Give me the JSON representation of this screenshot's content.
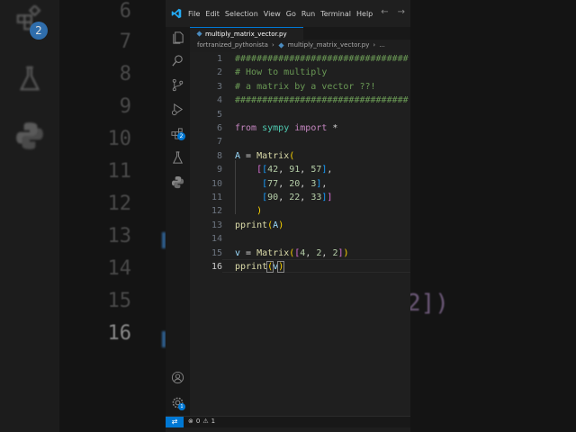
{
  "background": {
    "line_numbers": [
      "6",
      "7",
      "8",
      "9",
      "10",
      "11",
      "12",
      "13",
      "14",
      "15",
      "16"
    ],
    "current_line": "16",
    "code_fragments": [
      "2])"
    ]
  },
  "menu": [
    "File",
    "Edit",
    "Selection",
    "View",
    "Go",
    "Run",
    "Terminal",
    "Help"
  ],
  "tab": {
    "filename": "multiply_matrix_vector.py"
  },
  "breadcrumb": {
    "folder": "fortranized_pythonista",
    "file": "multiply_matrix_vector.py",
    "more": "..."
  },
  "activity_badges": {
    "extensions": "2",
    "settings": "1"
  },
  "editor": {
    "current_line": 16,
    "lines": [
      {
        "n": "1",
        "tokens": [
          {
            "c": "cmt",
            "t": "################################"
          }
        ]
      },
      {
        "n": "2",
        "tokens": [
          {
            "c": "cmt",
            "t": "# How to multiply"
          }
        ]
      },
      {
        "n": "3",
        "tokens": [
          {
            "c": "cmt",
            "t": "# a matrix by a vector ??!"
          }
        ]
      },
      {
        "n": "4",
        "tokens": [
          {
            "c": "cmt",
            "t": "################################"
          }
        ]
      },
      {
        "n": "5",
        "tokens": []
      },
      {
        "n": "6",
        "tokens": [
          {
            "c": "kw",
            "t": "from"
          },
          {
            "c": "op",
            "t": " "
          },
          {
            "c": "mod",
            "t": "sympy"
          },
          {
            "c": "op",
            "t": " "
          },
          {
            "c": "kw",
            "t": "import"
          },
          {
            "c": "op",
            "t": " *"
          }
        ]
      },
      {
        "n": "7",
        "tokens": []
      },
      {
        "n": "8",
        "tokens": [
          {
            "c": "var",
            "t": "A"
          },
          {
            "c": "op",
            "t": " = "
          },
          {
            "c": "fn",
            "t": "Matrix"
          },
          {
            "c": "p1",
            "t": "("
          }
        ]
      },
      {
        "n": "9",
        "tokens": [
          {
            "c": "op",
            "t": "    "
          },
          {
            "c": "p2",
            "t": "["
          },
          {
            "c": "p3",
            "t": "["
          },
          {
            "c": "num",
            "t": "42"
          },
          {
            "c": "op",
            "t": ", "
          },
          {
            "c": "num",
            "t": "91"
          },
          {
            "c": "op",
            "t": ", "
          },
          {
            "c": "num",
            "t": "57"
          },
          {
            "c": "p3",
            "t": "]"
          },
          {
            "c": "op",
            "t": ","
          }
        ]
      },
      {
        "n": "10",
        "tokens": [
          {
            "c": "op",
            "t": "     "
          },
          {
            "c": "p3",
            "t": "["
          },
          {
            "c": "num",
            "t": "77"
          },
          {
            "c": "op",
            "t": ", "
          },
          {
            "c": "num",
            "t": "20"
          },
          {
            "c": "op",
            "t": ", "
          },
          {
            "c": "num",
            "t": "3"
          },
          {
            "c": "p3",
            "t": "]"
          },
          {
            "c": "op",
            "t": ","
          }
        ]
      },
      {
        "n": "11",
        "tokens": [
          {
            "c": "op",
            "t": "     "
          },
          {
            "c": "p3",
            "t": "["
          },
          {
            "c": "num",
            "t": "90"
          },
          {
            "c": "op",
            "t": ", "
          },
          {
            "c": "num",
            "t": "22"
          },
          {
            "c": "op",
            "t": ", "
          },
          {
            "c": "num",
            "t": "33"
          },
          {
            "c": "p3",
            "t": "]"
          },
          {
            "c": "p2",
            "t": "]"
          }
        ]
      },
      {
        "n": "12",
        "tokens": [
          {
            "c": "op",
            "t": "    "
          },
          {
            "c": "p1",
            "t": ")"
          }
        ]
      },
      {
        "n": "13",
        "tokens": [
          {
            "c": "fn",
            "t": "pprint"
          },
          {
            "c": "p1",
            "t": "("
          },
          {
            "c": "var",
            "t": "A"
          },
          {
            "c": "p1",
            "t": ")"
          }
        ]
      },
      {
        "n": "14",
        "tokens": []
      },
      {
        "n": "15",
        "tokens": [
          {
            "c": "var",
            "t": "v"
          },
          {
            "c": "op",
            "t": " = "
          },
          {
            "c": "fn",
            "t": "Matrix"
          },
          {
            "c": "p1",
            "t": "("
          },
          {
            "c": "p2",
            "t": "["
          },
          {
            "c": "num",
            "t": "4"
          },
          {
            "c": "op",
            "t": ", "
          },
          {
            "c": "num",
            "t": "2"
          },
          {
            "c": "op",
            "t": ", "
          },
          {
            "c": "num",
            "t": "2"
          },
          {
            "c": "p2",
            "t": "]"
          },
          {
            "c": "p1",
            "t": ")"
          }
        ]
      },
      {
        "n": "16",
        "tokens": [
          {
            "c": "fn",
            "t": "pprint"
          },
          {
            "c": "p1 hl",
            "t": "("
          },
          {
            "c": "var",
            "t": "v"
          },
          {
            "c": "p1 hl",
            "t": ")"
          }
        ]
      }
    ]
  },
  "status": {
    "errors": "0",
    "warnings": "1"
  },
  "colors": {
    "accent": "#0078d4",
    "editor_bg": "#1f1f1f",
    "comment": "#6a9955",
    "keyword": "#c586c0"
  }
}
